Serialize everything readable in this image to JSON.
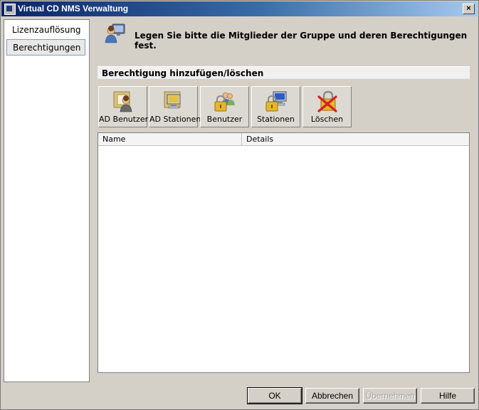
{
  "window": {
    "title": "Virtual CD NMS Verwaltung",
    "close_glyph": "×"
  },
  "nav": {
    "items": [
      {
        "label": "Lizenzauflösung",
        "selected": false
      },
      {
        "label": "Berechtigungen",
        "selected": true
      }
    ]
  },
  "header": {
    "icon": "users-monitor-icon",
    "text": "Legen Sie bitte die Mitglieder der Gruppe und deren Berechtigungen fest."
  },
  "section": {
    "title": "Berechtigung hinzufügen/löschen"
  },
  "toolbar": {
    "buttons": [
      {
        "label": "AD Benutzer",
        "icon": "ad-user-icon"
      },
      {
        "label": "AD Stationen",
        "icon": "ad-station-icon"
      },
      {
        "label": "Benutzer",
        "icon": "user-lock-icon"
      },
      {
        "label": "Stationen",
        "icon": "station-lock-icon"
      },
      {
        "label": "Löschen",
        "icon": "delete-lock-icon"
      }
    ]
  },
  "list": {
    "columns": [
      "Name",
      "Details"
    ],
    "rows": []
  },
  "footer": {
    "ok": "OK",
    "cancel": "Abbrechen",
    "apply": "Übernehmen",
    "help": "Hilfe"
  },
  "colors": {
    "title_start": "#0a246a",
    "title_end": "#a6caf0",
    "window_bg": "#d4d0c8",
    "section_bg": "#f0f0f0"
  }
}
